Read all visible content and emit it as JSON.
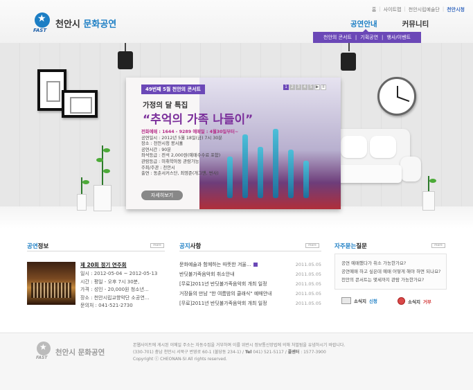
{
  "header": {
    "logo_fast": "FAST",
    "logo_city": "천안시",
    "logo_section": "문화공연",
    "util": [
      "홈",
      "사이트맵",
      "천안시립예술단",
      "천안시청"
    ],
    "gnb": [
      "공연안내",
      "커뮤니티"
    ],
    "subnav": [
      "천안의 콘서트",
      "기획공연",
      "행사/이벤트"
    ]
  },
  "hero": {
    "badge": "49번째 5월 천안의 콘서트",
    "pager": [
      "1",
      "2",
      "3",
      "4",
      "5",
      "▶",
      "II"
    ],
    "subtitle": "가정의 달 특집",
    "title": "“추억의 가족 나들이”",
    "ticket_line": "전화예매 : 1644 - 9289  예매일 : 4월30일부터~",
    "info": [
      "공연일시 : 2012년 5월 18일(금) 7시 30분",
      "장소 : 천안시청 봉서홀",
      "공연시간 : 90분",
      "좌석등급 : 전석 2,000원(예매수수료 포함)",
      "관람등급 : 미취학아동 관람가능",
      "주최/주관 : 천안시",
      "출연 : 동춘서커스단, 최영준(개그맨, 변사)"
    ],
    "detail_button": "자세히보기"
  },
  "performance": {
    "title_accent": "공연",
    "title_rest": "정보",
    "more": "more",
    "item_title": "제 20회 정기 연주회",
    "item_lines": [
      "일시 : 2012-05-04 ~ 2012-05-13",
      "시간 : 평일 - 오후 7시 30분,",
      "가격 : 성인 - 20,000원 청소년...",
      "장소 : 천안시립교향악단 소공연...",
      "문의처 : 041-521-2730"
    ]
  },
  "notice": {
    "title_accent": "공지",
    "title_rest": "사항",
    "more": "more",
    "items": [
      {
        "title": "문화예술과 함께하는 따뜻한 겨울...",
        "date": "2011.05.05"
      },
      {
        "title": "반딧불가족음악회 취소안내",
        "date": "2011.05.05"
      },
      {
        "title": "[무료]2011년 반딧불가족음악회 개최 일정",
        "date": "2011.05.05"
      },
      {
        "title": "거장들의 만남 \"한 여름밤의 클래식\" 예매안내",
        "date": "2011.05.05"
      },
      {
        "title": "[무료]2011년 반딧불가족음악회 개최 일정",
        "date": "2011.05.05"
      }
    ]
  },
  "faq": {
    "title_accent": "자주묻는",
    "title_rest": "질문",
    "more": "more",
    "items": [
      "공연 예매했다가 취소 가능한가요?",
      "공연예매 하고 싶은데 예매 어떻게 해야 하면 되나요?",
      "천안의 콘서트는 몇세까지 관람 가능한가요?"
    ],
    "sms_label": "소식지",
    "sms_apply": "신청",
    "sms_refuse": "거부"
  },
  "footer": {
    "fast": "FAST",
    "name": "천안시 문화공연",
    "line1": "본웹사이트에 게시된 이메일 주소는 자동수집을 거부하며 이를 위반시 정보통신망법에 의해 처벌됨을 유념하시기 바랍니다.",
    "line2_a": "(330-701) 충남 천안시 서북구 번영로 60-1 (불당동 234-1)  /  ",
    "line2_tel_label": "Tel",
    "line2_tel": " 041) 521-5117  /  ",
    "line2_call_label": "콜센터",
    "line2_call": " : 1577-3900",
    "line3": "Copyright ⓒ CHEONAN-SI All rights reserved."
  }
}
